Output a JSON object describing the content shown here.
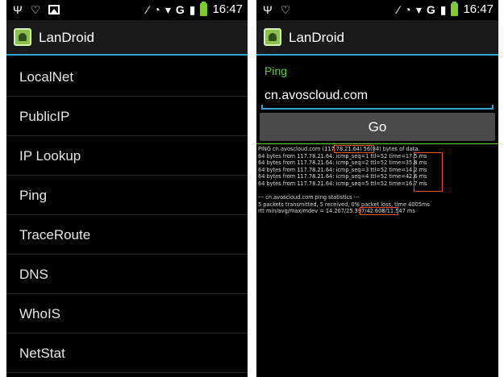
{
  "status_bar": {
    "time": "16:47",
    "network": "G"
  },
  "app": {
    "title": "LanDroid"
  },
  "menu": {
    "items": [
      "LocalNet",
      "PublicIP",
      "IP Lookup",
      "Ping",
      "TraceRoute",
      "DNS",
      "WhoIS",
      "NetStat"
    ]
  },
  "ping": {
    "label": "Ping",
    "host": "cn.avoscloud.com",
    "go_label": "Go",
    "output": {
      "header": "PING cn.avoscloud.com (117.78.21.64) 56(84) bytes of data.",
      "replies": [
        "64 bytes from 117.78.21.64: icmp_seq=1 ttl=52 time=17.5 ms",
        "64 bytes from 117.78.21.64: icmp_seq=2 ttl=52 time=35.8 ms",
        "64 bytes from 117.78.21.64: icmp_seq=3 ttl=52 time=14.2 ms",
        "64 bytes from 117.78.21.64: icmp_seq=4 ttl=52 time=42.6 ms",
        "64 bytes from 117.78.21.64: icmp_seq=5 ttl=52 time=16.7 ms"
      ],
      "stats_header": "--- cn.avoscloud.com ping statistics ---",
      "stats_packets": "5 packets transmitted, 5 received, 0% packet loss, time 4005ms",
      "stats_rtt": "rtt min/avg/max/mdev = 14.207/25.397/42.608/11.547 ms"
    }
  },
  "colors": {
    "accent_blue": "#33a3d4",
    "accent_green": "#66cc33",
    "highlight_red": "#e84a2f"
  }
}
